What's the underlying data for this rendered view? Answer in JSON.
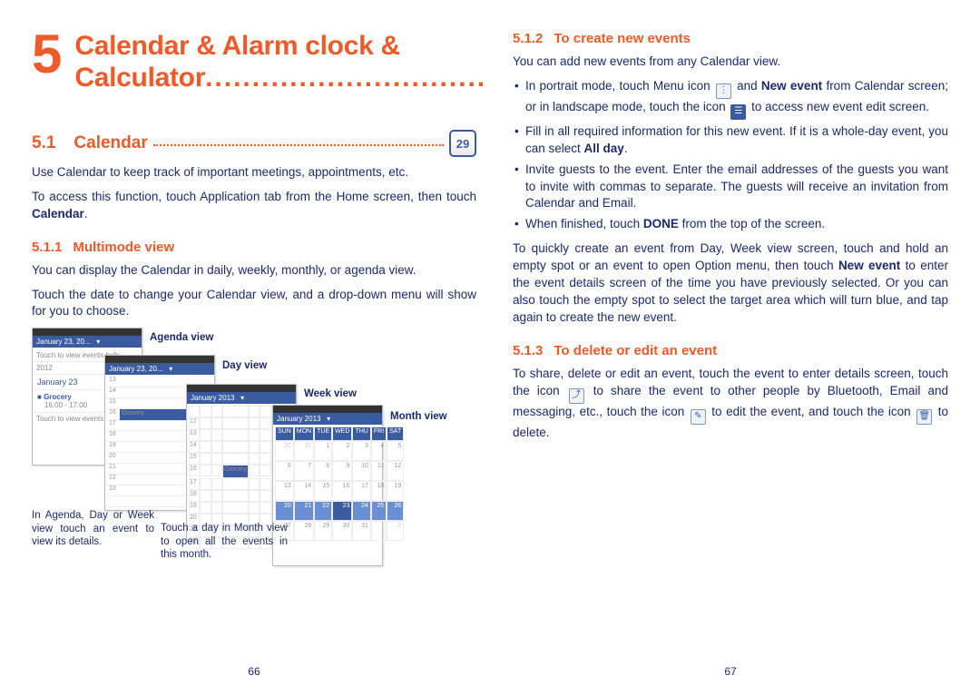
{
  "left": {
    "chapter_number": "5",
    "chapter_title": "Calendar & Alarm clock & Calculator",
    "section_number": "5.1",
    "section_title": "Calendar",
    "calendar_icon_day": "29",
    "intro_p1": "Use Calendar to keep track of important meetings, appointments, etc.",
    "intro_p2_a": "To access this function, touch Application tab from the Home screen, then touch ",
    "intro_p2_b": "Calendar",
    "intro_p2_c": ".",
    "sub1_num": "5.1.1",
    "sub1_title": "Multimode view",
    "sub1_p1": "You can display the Calendar in daily, weekly, monthly, or agenda view.",
    "sub1_p2": "Touch the date to change your Calendar view, and a drop-down menu will show for you to choose.",
    "labels": {
      "agenda": "Agenda view",
      "day": "Day view",
      "week": "Week view",
      "month": "Month view"
    },
    "shots": {
      "agenda_header": "January 23, 20...",
      "agenda_sub1": "Touch to view events befo",
      "agenda_sub2": "2012",
      "agenda_date": "January 23",
      "agenda_event": "Grocery",
      "agenda_time": "16:00 - 17:00",
      "agenda_sub3": "Touch to view events afte",
      "day_header": "January 23, 20...",
      "week_header": "January 2013",
      "week_event": "Grocery",
      "month_header": "January 2013",
      "month_days": [
        "SUN",
        "MON",
        "TUE",
        "WED",
        "THU",
        "FRI",
        "SAT"
      ]
    },
    "caption1": "In Agenda, Day or Week view touch an event to view its details.",
    "caption2": "Touch a day in Month view to open all the events in this month.",
    "page_number": "66"
  },
  "right": {
    "sub2_num": "5.1.2",
    "sub2_title": "To create new events",
    "sub2_p1": "You can add new events from any Calendar view.",
    "sub2_b1_a": "In portrait mode, touch Menu icon ",
    "sub2_b1_b": " and ",
    "sub2_b1_c": "New event",
    "sub2_b1_d": " from Calendar screen; or in landscape mode, touch the icon ",
    "sub2_b1_e": " to access new event edit screen.",
    "sub2_b2_a": "Fill in all required information for this new event. If it is a whole-day event, you can select ",
    "sub2_b2_b": "All day",
    "sub2_b2_c": ".",
    "sub2_b3": "Invite guests to the event. Enter the email addresses of the guests you want to invite with commas to separate. The guests will receive an invitation from Calendar and Email.",
    "sub2_b4_a": "When finished, touch ",
    "sub2_b4_b": "DONE",
    "sub2_b4_c": " from the top of the screen.",
    "sub2_p2_a": "To quickly create an event from Day, Week view screen, touch and hold an empty spot or an event to open Option menu, then touch ",
    "sub2_p2_b": "New event",
    "sub2_p2_c": " to enter the event details screen of the time you have previously selected. Or you can also touch the empty spot to select the target area which will turn blue, and tap again to create the new event.",
    "sub3_num": "5.1.3",
    "sub3_title": "To delete or edit an event",
    "sub3_p1_a": "To share, delete or edit an event, touch the event to enter details screen, touch the icon ",
    "sub3_p1_b": " to share the event to other people by Bluetooth, Email and messaging, etc., touch the icon ",
    "sub3_p1_c": " to edit the event, and touch the icon ",
    "sub3_p1_d": " to delete.",
    "page_number": "67"
  }
}
